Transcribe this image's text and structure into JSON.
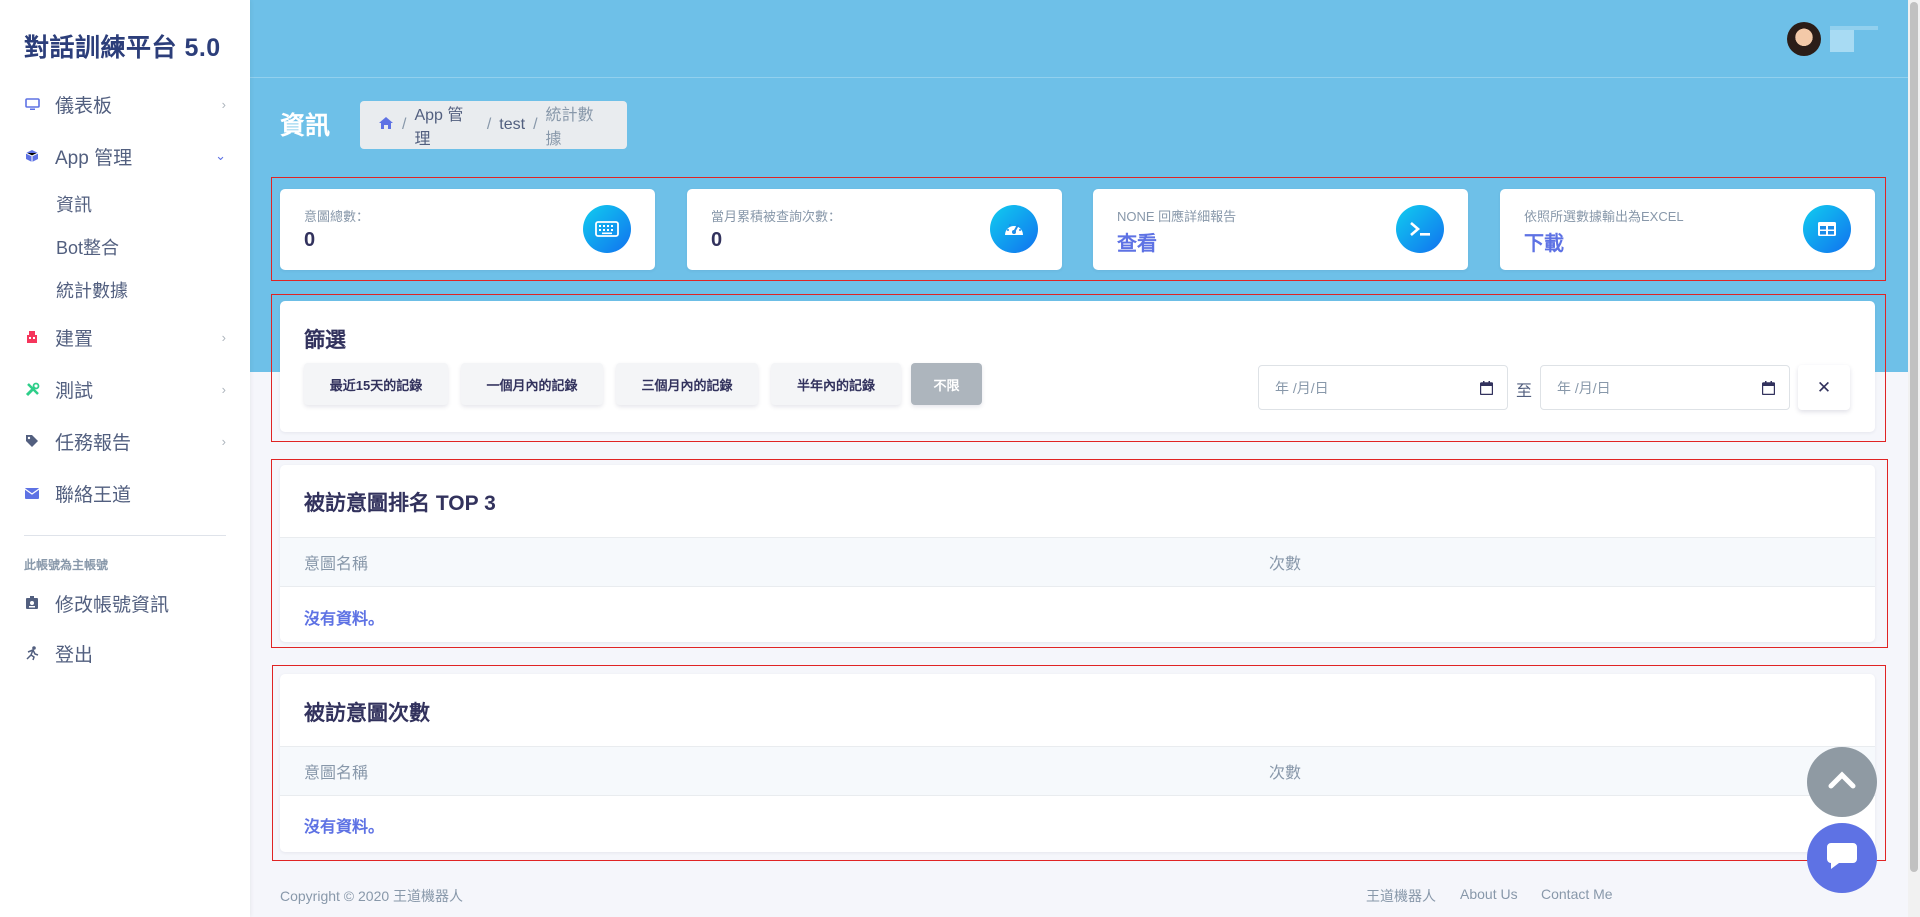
{
  "sidebar": {
    "brand": "對話訓練平台 5.0",
    "items": [
      {
        "label": "儀表板",
        "icon": "monitor-icon"
      },
      {
        "label": "App 管理",
        "icon": "cube-icon"
      },
      {
        "label": "建置",
        "icon": "building-icon"
      },
      {
        "label": "測試",
        "icon": "tools-icon"
      },
      {
        "label": "任務報告",
        "icon": "tag-icon"
      },
      {
        "label": "聯絡王道",
        "icon": "envelope-icon"
      }
    ],
    "sub_items": [
      "資訊",
      "Bot整合",
      "統計數據"
    ],
    "account_heading": "此帳號為主帳號",
    "account_items": [
      {
        "label": "修改帳號資訊",
        "icon": "id-badge-icon"
      },
      {
        "label": "登出",
        "icon": "running-icon"
      }
    ]
  },
  "header": {
    "page_title": "資訊",
    "breadcrumb": [
      "App 管理",
      "test",
      "統計數據"
    ]
  },
  "stats": [
    {
      "label": "意圖總數：",
      "value": "0",
      "icon": "keyboard-icon"
    },
    {
      "label": "當月累積被查詢次數：",
      "value": "0",
      "icon": "speedometer-icon"
    },
    {
      "label": "NONE 回應詳細報告",
      "link": "查看",
      "icon": "terminal-icon"
    },
    {
      "label": "依照所選數據輸出為EXCEL",
      "link": "下載",
      "icon": "table-icon"
    }
  ],
  "filter": {
    "title": "篩選",
    "buttons": [
      "最近15天的記錄",
      "一個月內的記錄",
      "三個月內的記錄",
      "半年內的記錄",
      "不限"
    ],
    "active_button": "不限",
    "date_from_placeholder": "年 /月/日",
    "date_to_placeholder": "年 /月/日",
    "to_label": "至",
    "clear_label": "✕"
  },
  "top3_table": {
    "title": "被訪意圖排名 TOP 3",
    "columns": [
      "意圖名稱",
      "次數"
    ],
    "empty_text": "沒有資料。"
  },
  "count_table": {
    "title": "被訪意圖次數",
    "columns": [
      "意圖名稱",
      "次數"
    ],
    "empty_text": "沒有資料。"
  },
  "footer": {
    "copyright": "Copyright © 2020 王道機器人",
    "links": [
      "王道機器人",
      "About Us",
      "Contact Me"
    ]
  },
  "colors": {
    "header_bg": "#6ec0e8",
    "primary": "#5e72e4",
    "icon_gradient_start": "#11cdef",
    "icon_gradient_end": "#1171ef",
    "highlight_box": "#e02424"
  }
}
